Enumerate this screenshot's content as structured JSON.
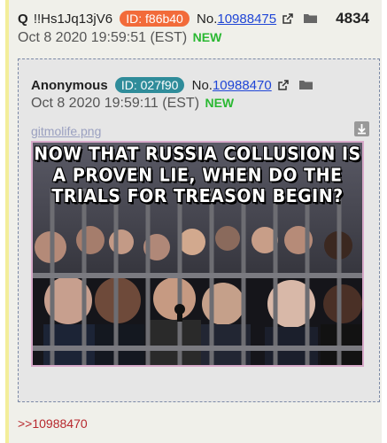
{
  "post": {
    "name": "Q",
    "tripcode": "!!Hs1Jq13jV6",
    "id_badge": "ID: f86b40",
    "number_prefix": "No.",
    "number": "10988475",
    "count": "4834",
    "date": "Oct 8 2020 19:59:51 (EST)",
    "new_label": "NEW",
    "reply_link": ">>10988470"
  },
  "quoted": {
    "name": "Anonymous",
    "id_badge": "ID: 027f90",
    "number_prefix": "No.",
    "number": "10988470",
    "date": "Oct 8 2020 19:59:11 (EST)",
    "new_label": "NEW",
    "filename": "gitmolife.png",
    "image_text": "NOW THAT RUSSIA COLLUSION IS A PROVEN LIE, WHEN DO THE TRIALS FOR TREASON BEGIN?"
  },
  "colors": {
    "id_orange": "#f26b3a",
    "id_teal": "#2f8c9a",
    "new_green": "#2ab832",
    "link_blue": "#2046d6",
    "reply_red": "#b7282d"
  },
  "icons": [
    "external-link-icon",
    "folder-icon",
    "download-icon"
  ]
}
